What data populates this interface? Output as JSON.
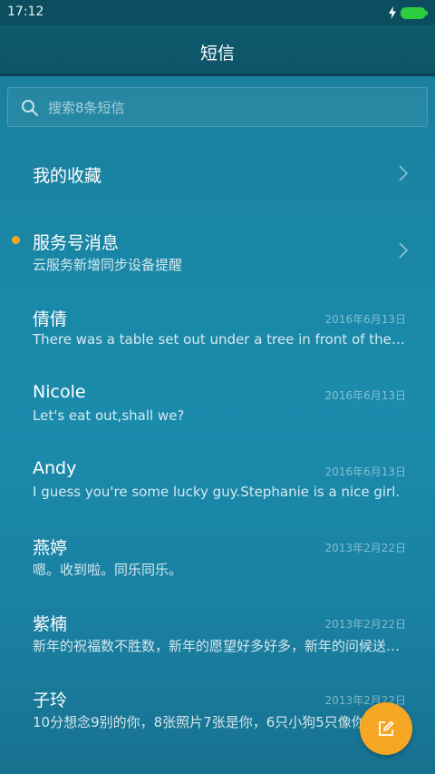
{
  "status_bar": {
    "time": "17:12"
  },
  "header": {
    "title": "短信"
  },
  "search": {
    "placeholder": "搜索8条短信"
  },
  "items": [
    {
      "title": "我的收藏",
      "preview": "",
      "date": "",
      "chevron": true,
      "unread": false
    },
    {
      "title": "服务号消息",
      "preview": "云服务新增同步设备提醒",
      "date": "",
      "chevron": true,
      "unread": true
    },
    {
      "title": "倩倩",
      "preview": "There was a table set out under a tree in front of the house",
      "date": "2016年6月13日",
      "chevron": false,
      "unread": false
    },
    {
      "title": "Nicole",
      "preview": "Let's eat out,shall we?",
      "date": "2016年6月13日",
      "chevron": false,
      "unread": false
    },
    {
      "title": "Andy",
      "preview": "I guess you're some lucky guy.Stephanie is a nice girl.",
      "date": "2016年6月13日",
      "chevron": false,
      "unread": false
    },
    {
      "title": "燕婷",
      "preview": "嗯。收到啦。同乐同乐。",
      "date": "2013年2月22日",
      "chevron": false,
      "unread": false
    },
    {
      "title": "紫楠",
      "preview": "新年的祝福数不胜数，新年的愿望好多好多，新年的问候送给你",
      "date": "2013年2月22日",
      "chevron": false,
      "unread": false
    },
    {
      "title": "子玲",
      "preview": "10分想念9别的你，8张照片7张是你，6只小狗5只像你",
      "date": "2013年2月22日",
      "chevron": false,
      "unread": false
    }
  ],
  "colors": {
    "accent": "#f5a623",
    "battery": "#2ecc40",
    "header_bg": "#0f5a6e",
    "list_bg": "#1a86a6"
  },
  "icons": {
    "search": "search-icon",
    "chevron": "chevron-right-icon",
    "compose": "compose-icon",
    "bolt": "bolt-icon",
    "battery": "battery-icon"
  }
}
